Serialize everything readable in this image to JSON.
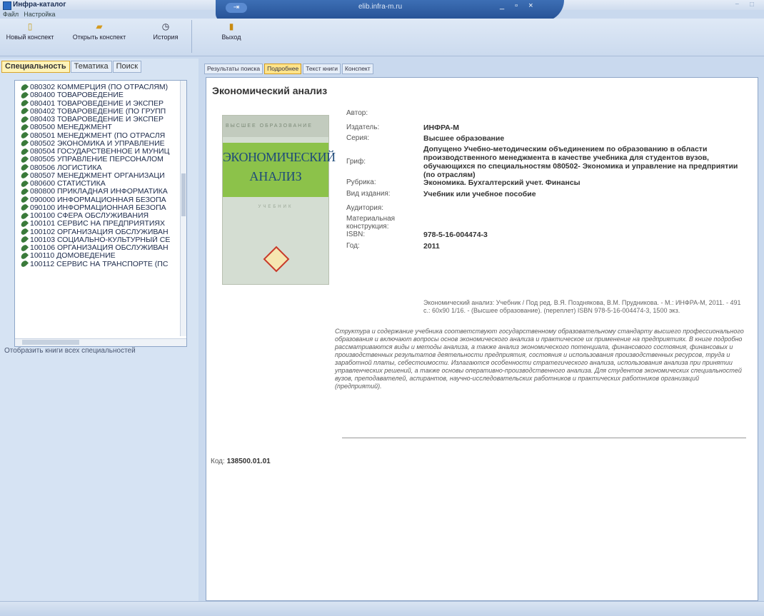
{
  "app": {
    "title": "Инфра-каталог",
    "url": "elib.infra-m.ru"
  },
  "menu": [
    "Файл",
    "Настройка"
  ],
  "toolbar": {
    "new_label": "Новый конспект",
    "open_label": "Открыть конспект",
    "history_label": "История",
    "exit_label": "Выход"
  },
  "left": {
    "tabs": [
      "Специальность",
      "Тематика",
      "Поиск"
    ],
    "items": [
      "080302 КОММЕРЦИЯ (ПО ОТРАСЛЯМ)",
      "080400 ТОВАРОВЕДЕНИЕ",
      "080401 ТОВАРОВЕДЕНИЕ И ЭКСПЕР",
      "080402 ТОВАРОВЕДЕНИЕ (ПО ГРУПП",
      "080403 ТОВАРОВЕДЕНИЕ И ЭКСПЕР",
      "080500 МЕНЕДЖМЕНТ",
      "080501 МЕНЕДЖМЕНТ (ПО ОТРАСЛЯ",
      "080502 ЭКОНОМИКА И УПРАВЛЕНИЕ",
      "080504 ГОСУДАРСТВЕННОЕ И МУНИЦ",
      "080505 УПРАВЛЕНИЕ ПЕРСОНАЛОМ",
      "080506 ЛОГИСТИКА",
      "080507 МЕНЕДЖМЕНТ ОРГАНИЗАЦИ",
      "080600 СТАТИСТИКА",
      "080800 ПРИКЛАДНАЯ ИНФОРМАТИКА",
      "090000 ИНФОРМАЦИОННАЯ БЕЗОПА",
      "090100 ИНФОРМАЦИОННАЯ БЕЗОПА",
      "100100 СФЕРА ОБСЛУЖИВАНИЯ",
      "100101 СЕРВИС НА ПРЕДПРИЯТИЯХ",
      "100102 ОРГАНИЗАЦИЯ ОБСЛУЖИВАН",
      "100103 СОЦИАЛЬНО-КУЛЬТУРНЫЙ СЕ",
      "100106 ОРГАНИЗАЦИЯ ОБСЛУЖИВАН",
      "100110 ДОМОВЕДЕНИЕ",
      "100112 СЕРВИС НА ТРАНСПОРТЕ (ПС"
    ],
    "show_all": "Отобразить книги всех специальностей"
  },
  "right": {
    "tabs": [
      "Результаты поиска",
      "Подробнее",
      "Текст книги",
      "Конспект"
    ],
    "active_tab": "Подробнее"
  },
  "book": {
    "title": "Экономический анализ",
    "cover": {
      "series": "ВЫСШЕЕ ОБРАЗОВАНИЕ",
      "title_line1": "ЭКОНОМИЧЕСКИЙ",
      "title_line2": "АНАЛИЗ",
      "subtitle": "УЧЕБНИК"
    },
    "fields": [
      {
        "label": "Автор:",
        "value": ""
      },
      {
        "label": "Издатель:",
        "value": "ИНФРА-М"
      },
      {
        "label": "Серия:",
        "value": "Высшее образование"
      },
      {
        "label": "Гриф:",
        "value": "Допущено Учебно-методическим объединением по образованию в области производственного менеджмента в качестве учебника для студентов вузов, обучающихся по специальностям 080502- Экономика и управление на предприятии (по отраслям)"
      },
      {
        "label": "Рубрика:",
        "value": "Экономика. Бухгалтерский учет. Финансы"
      },
      {
        "label": "Вид издания:",
        "value": "Учебник или учебное пособие"
      },
      {
        "label": "Аудитория:",
        "value": ""
      },
      {
        "label": "Материальная конструкция:",
        "value": ""
      },
      {
        "label": "ISBN:",
        "value": "978-5-16-004474-3"
      },
      {
        "label": "Год:",
        "value": "2011"
      }
    ],
    "bibliography": "Экономический анализ: Учебник / Под ред. В.Я. Позднякова, В.М. Прудникова. - М.: ИНФРА-М, 2011. - 491 с.: 60х90 1/16. - (Высшее образование). (переплет) ISBN 978-5-16-004474-3, 1500 экз.",
    "annotation": "Структура и содержание учебника соответствуют государственному образовательному стандарту высшего профессионального образования и включают вопросы основ экономического анализа и практическое их применение на предприятиях. В книге подробно рассматриваются виды и методы анализа, а также анализ экономического потенциала, финансового состояния, финансовых и производственных результатов деятельности предприятия, состояния и использования производственных ресурсов, труда и заработной платы, себестоимости. Излагаются особенности стратегического анализа, использования анализа при принятии управленческих решений, а также основы оперативно-производственного анализа. Для студентов экономических специальностей вузов, преподавателей, аспирантов, научно-исследовательских работников и практических работников организаций (предприятий).",
    "code_label": "Код:",
    "code": "138500.01.01"
  }
}
